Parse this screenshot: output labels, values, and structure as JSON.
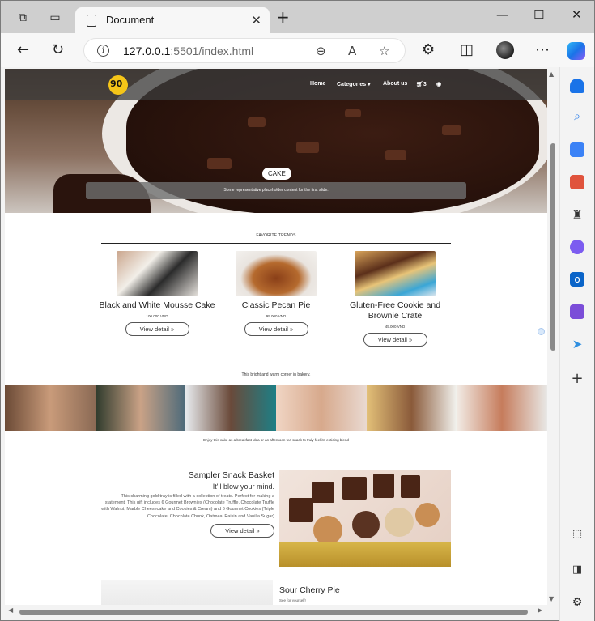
{
  "browser": {
    "tab_title": "Document",
    "url_host": "127.0.0.1",
    "url_rest": ":5501/index.html"
  },
  "site": {
    "logo_text": "90",
    "nav": {
      "home": "Home",
      "categories": "Categories ▾",
      "about": "About us",
      "cart_count": "3"
    },
    "hero": {
      "badge": "CAKE",
      "caption": "Some representative placeholder content for the first slide."
    },
    "trends_title": "FAVORITE TRENDS",
    "products": [
      {
        "name": "Black and White Mousse Cake",
        "price": "100.000 VND",
        "button": "View detail »"
      },
      {
        "name": "Classic Pecan Pie",
        "price": "95.000 VND",
        "button": "View detail »"
      },
      {
        "name": "Gluten-Free Cookie and Brownie Crate",
        "price": "45.000 VND",
        "button": "View detail »"
      }
    ],
    "bakery_note": "This bright and warm corner in bakery.",
    "enjoy_note": "Enjoy this cake as a breakfast idea or an afternoon tea snack to truly feel its enticing blend",
    "feature": {
      "title": "Sampler Snack Basket",
      "subtitle": "It'll blow your mind.",
      "description": "This charming gold tray is filled with a collection of treats. Perfect for making a statement. This gift includes 6 Gourmet Brownies (Chocolate Truffle, Chocolate Truffle with Walnut, Marble Cheesecake and Cookies & Cream) and 6 Gourmet Cookies (Triple Chocolate, Chocolate Chunk, Oatmeal Raisin and Vanilla Sugar)",
      "button": "View detail »"
    },
    "sour": {
      "title": "Sour Cherry Pie",
      "subtitle": "See for yourself!"
    }
  },
  "colors": {
    "accent_logo": "#f5c518",
    "nav_overlay": "#3c3c3c",
    "edge_blue": "#1a73e8"
  }
}
